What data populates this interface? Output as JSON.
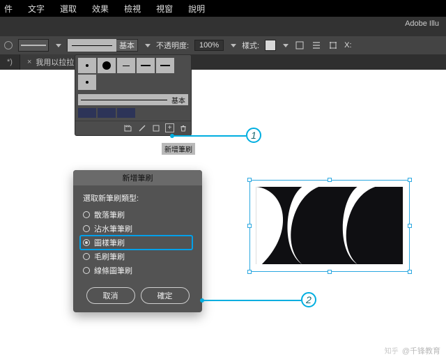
{
  "menubar": [
    "件",
    "文字",
    "選取",
    "效果",
    "檢視",
    "視窗",
    "說明"
  ],
  "app_name": "Adobe Illu",
  "options": {
    "basic_label": "基本",
    "opacity_label": "不透明度:",
    "opacity_value": "100%",
    "style_label": "樣式:",
    "x_label": "X:"
  },
  "tabs": [
    {
      "label": "*)"
    },
    {
      "label": "我用以拉拉的."
    }
  ],
  "brushes": {
    "basic_strip": "基本",
    "tooltip": "新增筆刷"
  },
  "dialog": {
    "title": "新增筆刷",
    "prompt": "選取新筆刷類型:",
    "options": [
      "散落筆刷",
      "沾水筆筆刷",
      "圖樣筆刷",
      "毛刷筆刷",
      "線條圖筆刷"
    ],
    "selected_index": 2,
    "cancel": "取消",
    "ok": "確定"
  },
  "annotations": {
    "step1": "1",
    "step2": "2"
  },
  "watermark": {
    "brand": "知乎",
    "author": "@千锋教育"
  }
}
